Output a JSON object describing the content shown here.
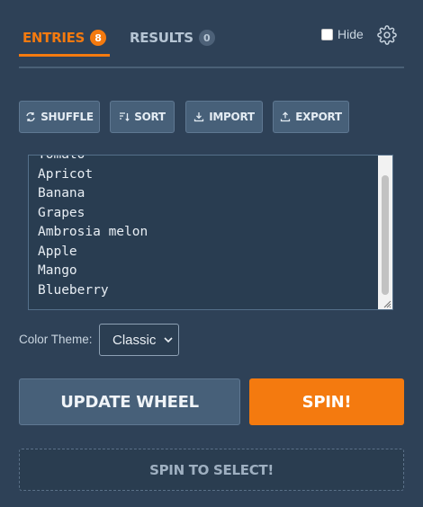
{
  "tabs": {
    "entries": {
      "label": "ENTRIES",
      "count": "8"
    },
    "results": {
      "label": "RESULTS",
      "count": "0"
    }
  },
  "hide": {
    "label": "Hide",
    "checked": false
  },
  "settings_icon": "gear-icon",
  "toolbar": {
    "shuffle_label": "SHUFFLE",
    "sort_label": "SORT",
    "import_label": "IMPORT",
    "export_label": "EXPORT"
  },
  "entries_text": "Tomato\nApricot\nBanana\nGrapes\nAmbrosia melon\nApple\nMango\nBlueberry",
  "theme": {
    "label": "Color Theme:",
    "selected": "Classic"
  },
  "buttons": {
    "update": "UPDATE WHEEL",
    "spin": "SPIN!",
    "spin_to_select": "SPIN TO SELECT!"
  },
  "colors": {
    "accent": "#f47a0f",
    "background": "#2e4157",
    "button": "#476079"
  }
}
